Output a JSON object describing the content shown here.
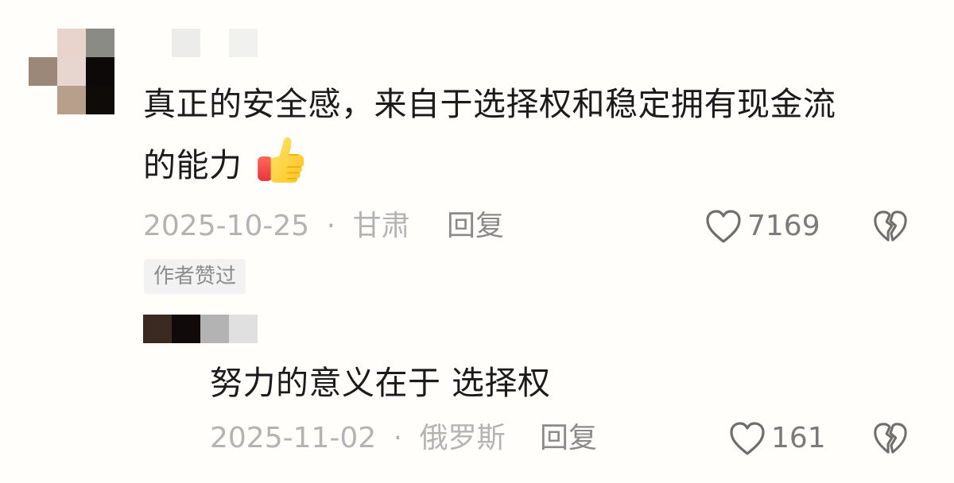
{
  "comments": [
    {
      "text_line1": "真正的安全感，来自于选择权和稳定拥有现金流",
      "text_line2": "的能力",
      "emoji": "thumbs-up",
      "date": "2025-10-25",
      "location": "甘肃",
      "separator": "·",
      "reply_label": "回复",
      "like_count": "7169",
      "author_badge": "作者赞过"
    },
    {
      "text": "努力的意义在于 选择权",
      "date": "2025-11-02",
      "location": "俄罗斯",
      "separator": "·",
      "reply_label": "回复",
      "like_count": "161"
    }
  ],
  "icons": {
    "like": "heart-outline-icon",
    "dislike": "broken-heart-icon",
    "emoji": "thumbs-up-emoji"
  }
}
